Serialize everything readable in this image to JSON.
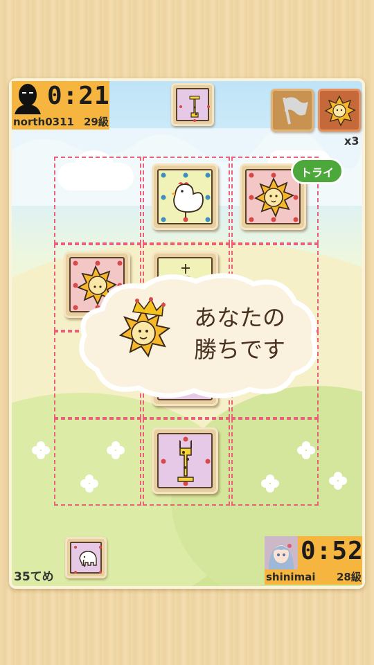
{
  "opponent": {
    "timer": "0:21",
    "name": "north0311",
    "rank": "29級",
    "avatar_icon": "silhouette-avatar-icon"
  },
  "player": {
    "timer": "0:52",
    "name": "shinimai",
    "rank": "28級",
    "avatar_icon": "anime-girl-avatar-icon"
  },
  "opponent_hand": [
    "giraffe"
  ],
  "player_hand": [
    "elephant"
  ],
  "hud": {
    "resign_icon": "flag-icon",
    "hint_piece": "lion",
    "multiplier": "x3"
  },
  "board": {
    "pieces": [
      {
        "row": 0,
        "col": 1,
        "piece": "chicken",
        "owner": "player"
      },
      {
        "row": 0,
        "col": 2,
        "piece": "lion",
        "owner": "player"
      },
      {
        "row": 1,
        "col": 0,
        "piece": "lion",
        "owner": "opponent"
      },
      {
        "row": 1,
        "col": 1,
        "piece": "chick",
        "owner": "player"
      },
      {
        "row": 3,
        "col": 1,
        "piece": "giraffe",
        "owner": "player"
      }
    ]
  },
  "try_bubble": "トライ",
  "result": {
    "line1": "あなたの",
    "line2": "勝ちです",
    "icon": "crowned-lion-icon"
  },
  "move_count": "35てめ",
  "colors": {
    "timer_bg": "#f6b53e",
    "grid_line": "#e8607a",
    "try_bubble": "#4ca83a",
    "pink_tile": "#f4c7c7",
    "green_tile": "#f0f2b8",
    "purple_tile": "#e5c9e6"
  }
}
